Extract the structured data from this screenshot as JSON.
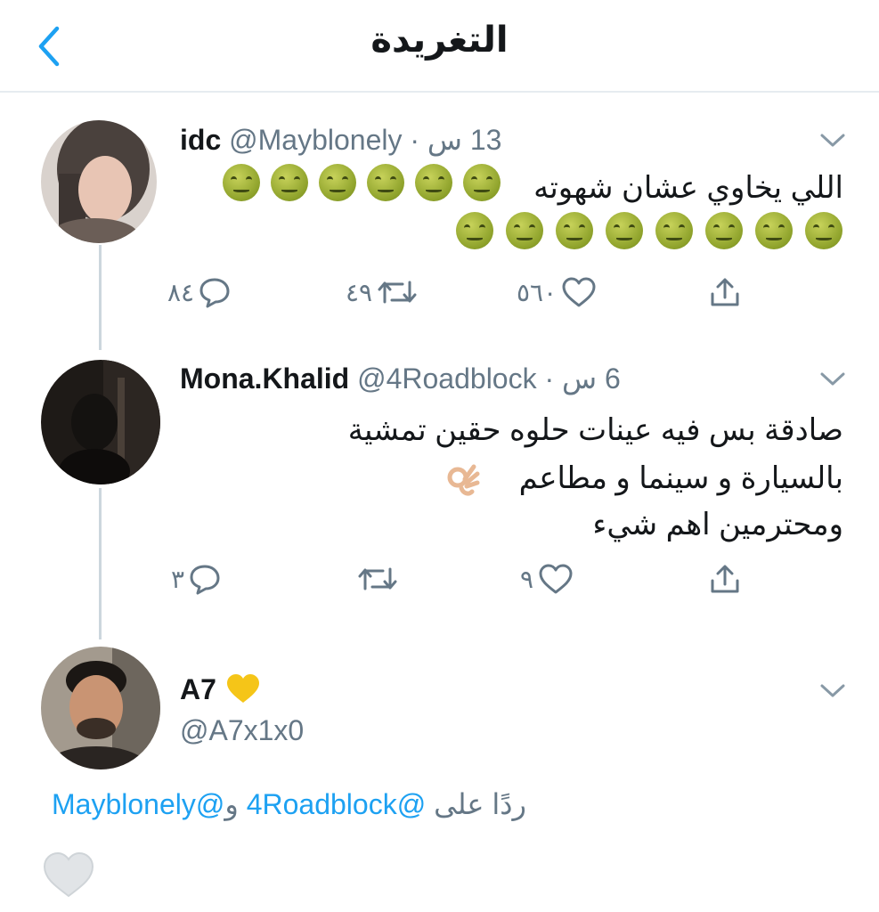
{
  "header": {
    "title": "التغريدة",
    "back_icon": "chevron-left-icon",
    "accent": "#1da1f2"
  },
  "tweets": [
    {
      "display_name": "idc",
      "handle": "@Mayblonely",
      "separator": "·",
      "time": "13 س",
      "text": "اللي يخاوي عشان شهوته",
      "emoji": "nauseated-face",
      "emoji_count": 14,
      "replies": "٨٤",
      "retweets": "٤٩",
      "likes": "٥٦٠"
    },
    {
      "display_name": "Mona.Khalid",
      "handle": "@4Roadblock",
      "separator": "·",
      "time": "6 س",
      "lines": [
        "صادقة بس فيه عينات حلوه حقين تمشية",
        "بالسيارة و سينما و مطاعم",
        "ومحترمين اهم شيء"
      ],
      "emoji": "ok-hand",
      "replies": "٣",
      "retweets": "",
      "likes": "٩"
    }
  ],
  "main_tweet": {
    "display_name": "A7",
    "handle": "@A7x1x0",
    "name_emoji": "yellow-heart",
    "reply_label": "ردًا على",
    "reply_handle_1": "@4Roadblock",
    "reply_conj": "و",
    "reply_handle_2": "@Mayblonely"
  },
  "colors": {
    "text": "#14171a",
    "secondary": "#657786",
    "link": "#1da1f2",
    "divider": "#e6ecf0",
    "yellow_heart": "#f5c518"
  }
}
